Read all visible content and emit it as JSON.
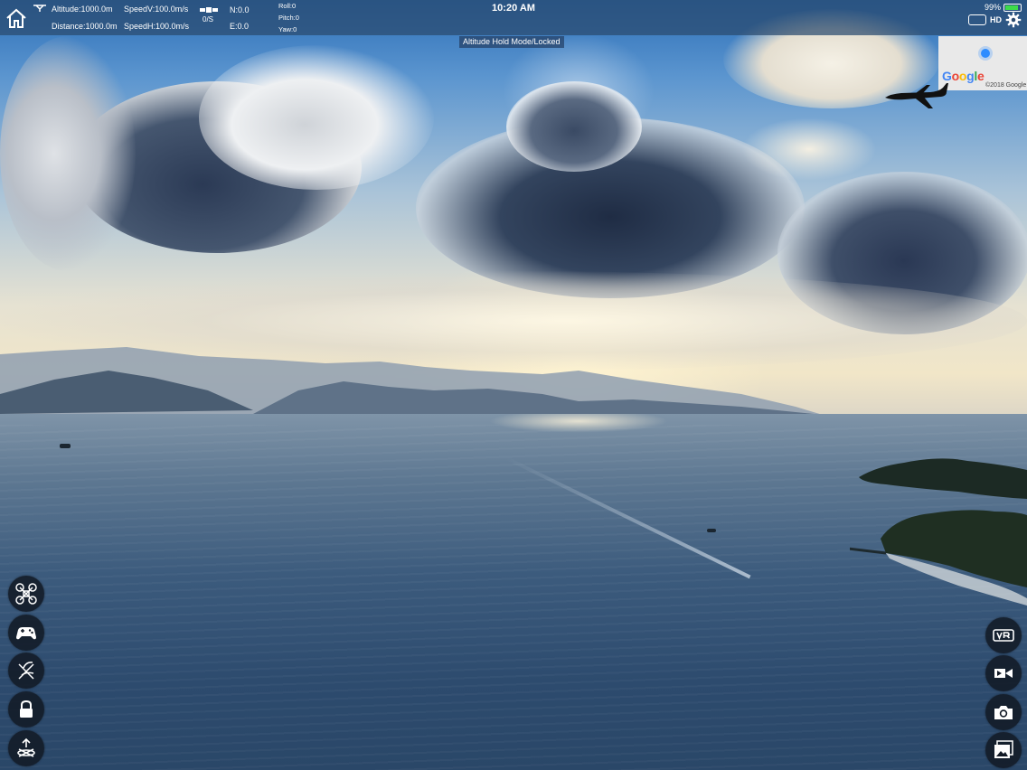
{
  "status_bar": {
    "time": "10:20 AM",
    "battery_percent": "99%"
  },
  "telemetry": {
    "altitude": "Altitude:1000.0m",
    "distance": "Distance:1000.0m",
    "speed_v": "SpeedV:100.0m/s",
    "speed_h": "SpeedH:100.0m/s",
    "satellites": "0/S",
    "north": "N:0.0",
    "east": "E:0.0",
    "roll": "Roll:0",
    "pitch": "Pitch:0",
    "yaw": "Yaw:0"
  },
  "hd_label": "HD",
  "mode_banner": "Altitude Hold Mode/Locked",
  "map": {
    "brand": "Google",
    "copyright": "©2018 Google"
  },
  "icons": {
    "home": "home-icon",
    "settings": "gear-icon",
    "left_column": [
      "drone-icon",
      "gamepad-icon",
      "takeoff-landing-icon",
      "lock-icon",
      "return-home-icon"
    ],
    "right_column": [
      "vr-icon",
      "video-record-icon",
      "camera-icon",
      "gallery-icon"
    ]
  },
  "colors": {
    "topbar": "#2a4a6e",
    "battery": "#3ddc4a",
    "button_bg": "#121a26",
    "location_dot": "#2d8cff"
  }
}
